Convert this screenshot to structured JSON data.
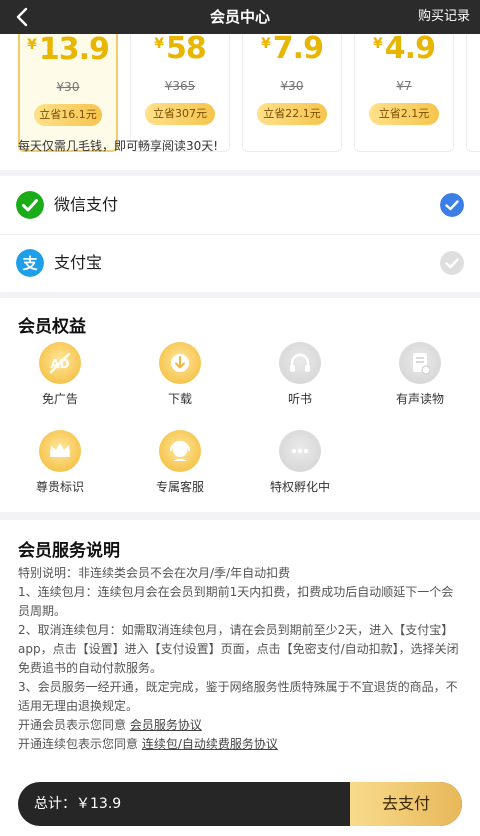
{
  "header": {
    "title": "会员中心",
    "record": "购买记录"
  },
  "plans": [
    {
      "currency": "¥",
      "price": "13.9",
      "original": "¥30",
      "save": "立省16.1元",
      "selected": true
    },
    {
      "currency": "¥",
      "price": "58",
      "original": "¥365",
      "save": "立省307元",
      "selected": false
    },
    {
      "currency": "¥",
      "price": "7.9",
      "original": "¥30",
      "save": "立省22.1元",
      "selected": false
    },
    {
      "currency": "¥",
      "price": "4.9",
      "original": "¥7",
      "save": "立省2.1元",
      "selected": false
    }
  ],
  "tip": "每天仅需几毛钱，即可畅享阅读30天!",
  "payment": {
    "options": [
      {
        "name": "微信支付",
        "icon": "wechat-pay-icon",
        "checked": true
      },
      {
        "name": "支付宝",
        "icon": "alipay-icon",
        "checked": false
      }
    ]
  },
  "benefits": {
    "title": "会员权益",
    "items": [
      {
        "label": "免广告",
        "icon": "no-ads-icon",
        "style": "gold"
      },
      {
        "label": "下载",
        "icon": "download-icon",
        "style": "gold"
      },
      {
        "label": "听书",
        "icon": "headphones-icon",
        "style": "gray"
      },
      {
        "label": "有声读物",
        "icon": "audiobook-icon",
        "style": "gray"
      },
      {
        "label": "尊贵标识",
        "icon": "crown-icon",
        "style": "gold"
      },
      {
        "label": "专属客服",
        "icon": "customer-service-icon",
        "style": "gold"
      },
      {
        "label": "特权孵化中",
        "icon": "more-icon",
        "style": "gray"
      }
    ]
  },
  "service": {
    "title": "会员服务说明",
    "lines": [
      "特别说明：非连续类会员不会在次月/季/年自动扣费",
      "1、连续包月：连续包月会在会员到期前1天内扣费，扣费成功后自动顺延下一个会员周期。",
      "2、取消连续包月：如需取消连续包月，请在会员到期前至少2天，进入【支付宝】app，点击【设置】进入【支付设置】页面，点击【免密支付/自动扣款】，选择关闭免费追书的自动付款服务。",
      "3、会员服务一经开通，既定完成，鉴于网络服务性质特殊属于不宜退货的商品，不适用无理由退换规定。"
    ],
    "agree1_prefix": "开通会员表示您同意 ",
    "agree1_link": "会员服务协议",
    "agree2_prefix": "开通连续包表示您同意 ",
    "agree2_link": "连续包/自动续费服务协议"
  },
  "footer": {
    "total_label": "总计：￥13.9",
    "pay_button": "去支付"
  },
  "colors": {
    "accent_gold": "#e8b500",
    "wechat_green": "#1aad19",
    "alipay_blue": "#1e9fe8",
    "check_blue": "#3b7ee8"
  }
}
